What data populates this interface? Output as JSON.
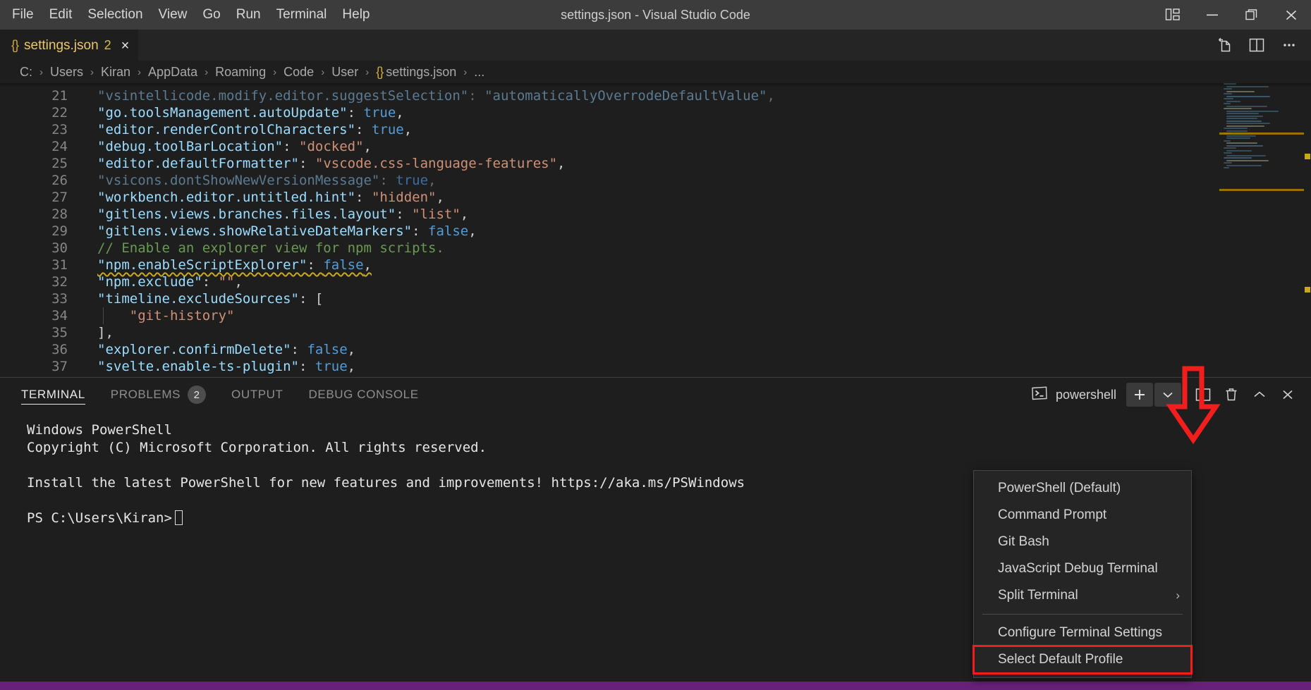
{
  "window": {
    "title": "settings.json - Visual Studio Code",
    "menu": [
      "File",
      "Edit",
      "Selection",
      "View",
      "Go",
      "Run",
      "Terminal",
      "Help"
    ],
    "controls": {
      "layout": "layout-panel-icon",
      "minimize": "minimize-icon",
      "maximize": "maximize-restore-icon",
      "close": "close-icon"
    }
  },
  "tabs": [
    {
      "icon": "json-braces-icon",
      "name": "settings.json",
      "modified_count": "2",
      "close": "×"
    }
  ],
  "editor_actions": [
    "split-editor-right-icon",
    "open-changes-icon",
    "more-actions-icon"
  ],
  "breadcrumbs": {
    "items": [
      "C:",
      "Users",
      "Kiran",
      "AppData",
      "Roaming",
      "Code",
      "User",
      "settings.json",
      "..."
    ],
    "separator": "›",
    "file_icon": "json-braces-icon"
  },
  "code": {
    "first_line_number": 21,
    "lines": [
      {
        "n": 21,
        "dim": true,
        "squiggle": false,
        "tokens": [
          {
            "t": "\"vsintellicode.modify.editor.suggestSelection\"",
            "c": "key-dim"
          },
          {
            "t": ": ",
            "c": "punct-dim"
          },
          {
            "t": "\"automaticallyOverrodeDefaultValue\"",
            "c": "str-dim"
          },
          {
            "t": ",",
            "c": "punct-dim"
          }
        ]
      },
      {
        "n": 22,
        "dim": false,
        "squiggle": false,
        "tokens": [
          {
            "t": "\"go.toolsManagement.autoUpdate\"",
            "c": "key"
          },
          {
            "t": ": ",
            "c": "punct"
          },
          {
            "t": "true",
            "c": "bool"
          },
          {
            "t": ",",
            "c": "punct"
          }
        ]
      },
      {
        "n": 23,
        "dim": false,
        "squiggle": false,
        "tokens": [
          {
            "t": "\"editor.renderControlCharacters\"",
            "c": "key"
          },
          {
            "t": ": ",
            "c": "punct"
          },
          {
            "t": "true",
            "c": "bool"
          },
          {
            "t": ",",
            "c": "punct"
          }
        ]
      },
      {
        "n": 24,
        "dim": false,
        "squiggle": false,
        "tokens": [
          {
            "t": "\"debug.toolBarLocation\"",
            "c": "key"
          },
          {
            "t": ": ",
            "c": "punct"
          },
          {
            "t": "\"docked\"",
            "c": "str"
          },
          {
            "t": ",",
            "c": "punct"
          }
        ]
      },
      {
        "n": 25,
        "dim": false,
        "squiggle": false,
        "tokens": [
          {
            "t": "\"editor.defaultFormatter\"",
            "c": "key"
          },
          {
            "t": ": ",
            "c": "punct"
          },
          {
            "t": "\"vscode.css-language-features\"",
            "c": "str"
          },
          {
            "t": ",",
            "c": "punct"
          }
        ]
      },
      {
        "n": 26,
        "dim": true,
        "squiggle": false,
        "tokens": [
          {
            "t": "\"vsicons.dontShowNewVersionMessage\"",
            "c": "key-dim"
          },
          {
            "t": ": ",
            "c": "punct-dim"
          },
          {
            "t": "true",
            "c": "bool-dim"
          },
          {
            "t": ",",
            "c": "punct-dim"
          }
        ]
      },
      {
        "n": 27,
        "dim": false,
        "squiggle": false,
        "tokens": [
          {
            "t": "\"workbench.editor.untitled.hint\"",
            "c": "key"
          },
          {
            "t": ": ",
            "c": "punct"
          },
          {
            "t": "\"hidden\"",
            "c": "str"
          },
          {
            "t": ",",
            "c": "punct"
          }
        ]
      },
      {
        "n": 28,
        "dim": false,
        "squiggle": false,
        "tokens": [
          {
            "t": "\"gitlens.views.branches.files.layout\"",
            "c": "key"
          },
          {
            "t": ": ",
            "c": "punct"
          },
          {
            "t": "\"list\"",
            "c": "str"
          },
          {
            "t": ",",
            "c": "punct"
          }
        ]
      },
      {
        "n": 29,
        "dim": false,
        "squiggle": false,
        "tokens": [
          {
            "t": "\"gitlens.views.showRelativeDateMarkers\"",
            "c": "key"
          },
          {
            "t": ": ",
            "c": "punct"
          },
          {
            "t": "false",
            "c": "bool"
          },
          {
            "t": ",",
            "c": "punct"
          }
        ]
      },
      {
        "n": 30,
        "dim": false,
        "squiggle": false,
        "tokens": [
          {
            "t": "// Enable an explorer view for npm scripts.",
            "c": "comment"
          }
        ]
      },
      {
        "n": 31,
        "dim": false,
        "squiggle": true,
        "tokens": [
          {
            "t": "\"npm.enableScriptExplorer\"",
            "c": "key"
          },
          {
            "t": ": ",
            "c": "punct"
          },
          {
            "t": "false",
            "c": "bool"
          },
          {
            "t": ",",
            "c": "punct"
          }
        ]
      },
      {
        "n": 32,
        "dim": false,
        "squiggle": false,
        "tokens": [
          {
            "t": "\"npm.exclude\"",
            "c": "key"
          },
          {
            "t": ": ",
            "c": "punct"
          },
          {
            "t": "\"\"",
            "c": "str"
          },
          {
            "t": ",",
            "c": "punct"
          }
        ]
      },
      {
        "n": 33,
        "dim": false,
        "squiggle": false,
        "tokens": [
          {
            "t": "\"timeline.excludeSources\"",
            "c": "key"
          },
          {
            "t": ": ",
            "c": "punct"
          },
          {
            "t": "[",
            "c": "punct"
          }
        ]
      },
      {
        "n": 34,
        "dim": false,
        "squiggle": false,
        "indent": true,
        "tokens": [
          {
            "t": "    \"git-history\"",
            "c": "str"
          }
        ]
      },
      {
        "n": 35,
        "dim": false,
        "squiggle": false,
        "tokens": [
          {
            "t": "],",
            "c": "punct"
          }
        ]
      },
      {
        "n": 36,
        "dim": false,
        "squiggle": false,
        "tokens": [
          {
            "t": "\"explorer.confirmDelete\"",
            "c": "key"
          },
          {
            "t": ": ",
            "c": "punct"
          },
          {
            "t": "false",
            "c": "bool"
          },
          {
            "t": ",",
            "c": "punct"
          }
        ]
      },
      {
        "n": 37,
        "dim": false,
        "squiggle": false,
        "tokens": [
          {
            "t": "\"svelte.enable-ts-plugin\"",
            "c": "key"
          },
          {
            "t": ": ",
            "c": "punct"
          },
          {
            "t": "true",
            "c": "bool"
          },
          {
            "t": ",",
            "c": "punct"
          }
        ]
      }
    ]
  },
  "panel": {
    "tabs": [
      {
        "label": "TERMINAL",
        "active": true,
        "badge": null
      },
      {
        "label": "PROBLEMS",
        "active": false,
        "badge": "2"
      },
      {
        "label": "OUTPUT",
        "active": false,
        "badge": null
      },
      {
        "label": "DEBUG CONSOLE",
        "active": false,
        "badge": null
      }
    ],
    "shell_label": "powershell",
    "shell_icon": "terminal-prompt-icon",
    "actions": [
      {
        "name": "new-terminal-button",
        "icon": "plus-icon"
      },
      {
        "name": "terminal-profile-dropdown-button",
        "icon": "chevron-down-icon"
      },
      {
        "name": "split-terminal-button",
        "icon": "split-panes-icon"
      },
      {
        "name": "kill-terminal-button",
        "icon": "trash-icon"
      },
      {
        "name": "maximize-panel-button",
        "icon": "chevron-up-icon"
      },
      {
        "name": "close-panel-button",
        "icon": "close-icon"
      }
    ],
    "terminal_output": [
      "Windows PowerShell",
      "Copyright (C) Microsoft Corporation. All rights reserved.",
      "",
      "Install the latest PowerShell for new features and improvements! https://aka.ms/PSWindows",
      "",
      "PS C:\\Users\\Kiran>"
    ]
  },
  "context_menu": {
    "items": [
      {
        "label": "PowerShell (Default)",
        "submenu": false,
        "highlighted": false
      },
      {
        "label": "Command Prompt",
        "submenu": false,
        "highlighted": false
      },
      {
        "label": "Git Bash",
        "submenu": false,
        "highlighted": false
      },
      {
        "label": "JavaScript Debug Terminal",
        "submenu": false,
        "highlighted": false
      },
      {
        "label": "Split Terminal",
        "submenu": true,
        "highlighted": false
      },
      {
        "separator": true
      },
      {
        "label": "Configure Terminal Settings",
        "submenu": false,
        "highlighted": false
      },
      {
        "label": "Select Default Profile",
        "submenu": false,
        "highlighted": true
      }
    ],
    "submenu_chevron": "›"
  },
  "annotations": {
    "arrow": {
      "name": "red-down-arrow",
      "color": "#f21e1e"
    },
    "highlight_box": {
      "name": "red-highlight-box",
      "color": "#f21e1e"
    }
  },
  "colors": {
    "titlebar_bg": "#3c3c3c",
    "editor_bg": "#1e1e1e",
    "panel_bg": "#1e1e1e",
    "statusbar_bg": "#68217a",
    "accent_yellow": "#e8c76e",
    "warning_squiggle": "#caa918",
    "menu_bg": "#252526"
  }
}
